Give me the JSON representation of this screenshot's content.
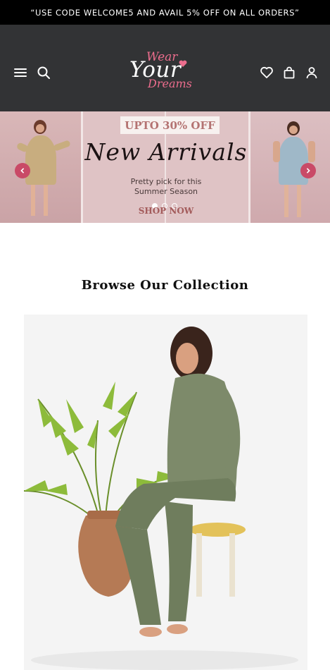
{
  "announcement": "“USE CODE WELCOME5 AND AVAIL 5% OFF ON ALL ORDERS”",
  "logo": {
    "line1": "Wear",
    "line2": "Your",
    "line3": "Dreams"
  },
  "icons": {
    "menu": "menu-icon",
    "search": "search-icon",
    "wishlist": "heart-icon",
    "cart": "shopping-bag-icon",
    "account": "user-icon"
  },
  "banner": {
    "offer": "UPTO 30% OFF",
    "headline": "New Arrivals",
    "subtext_line1": "Pretty pick for this",
    "subtext_line2": "Summer Season",
    "cta": "SHOP NOW",
    "prev_icon": "chevron-left-icon",
    "next_icon": "chevron-right-icon",
    "slides": 3,
    "active_slide": 1
  },
  "section": {
    "title": "Browse Our Collection"
  },
  "colors": {
    "header_bg": "#323335",
    "accent_pink": "#ec6d8d",
    "arrow_bg": "#c94a67",
    "offer_text": "#b47372"
  }
}
